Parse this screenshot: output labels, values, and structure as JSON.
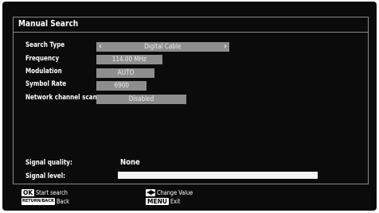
{
  "window": {
    "title": "Manual Search"
  },
  "settings": [
    {
      "label": "Search Type",
      "value": "Digital Cable",
      "left_arrow": "‹",
      "right_arrow": "›"
    },
    {
      "label": "Frequency",
      "value": "114.00 MHz"
    },
    {
      "label": "Modulation",
      "value": "AUTO"
    },
    {
      "label": "Symbol Rate",
      "value": "6900"
    },
    {
      "label": "Network channel scan",
      "value": "Disabled"
    }
  ],
  "signal": {
    "quality_label": "Signal quality:",
    "quality_value": "None",
    "level_label": "Signal level:",
    "level_fraction": 1.0
  },
  "footer": {
    "start": {
      "key": "OK",
      "text": "Start search"
    },
    "back": {
      "key": "RETURN/BACK",
      "text": "Back"
    },
    "change": {
      "key": "◀|▶",
      "text": "Change Value"
    },
    "exit": {
      "key": "MENU",
      "text": "Exit"
    }
  },
  "colors": {
    "background": "#0b0b0b",
    "field": "#8e8e8e",
    "text": "#ffffff"
  }
}
